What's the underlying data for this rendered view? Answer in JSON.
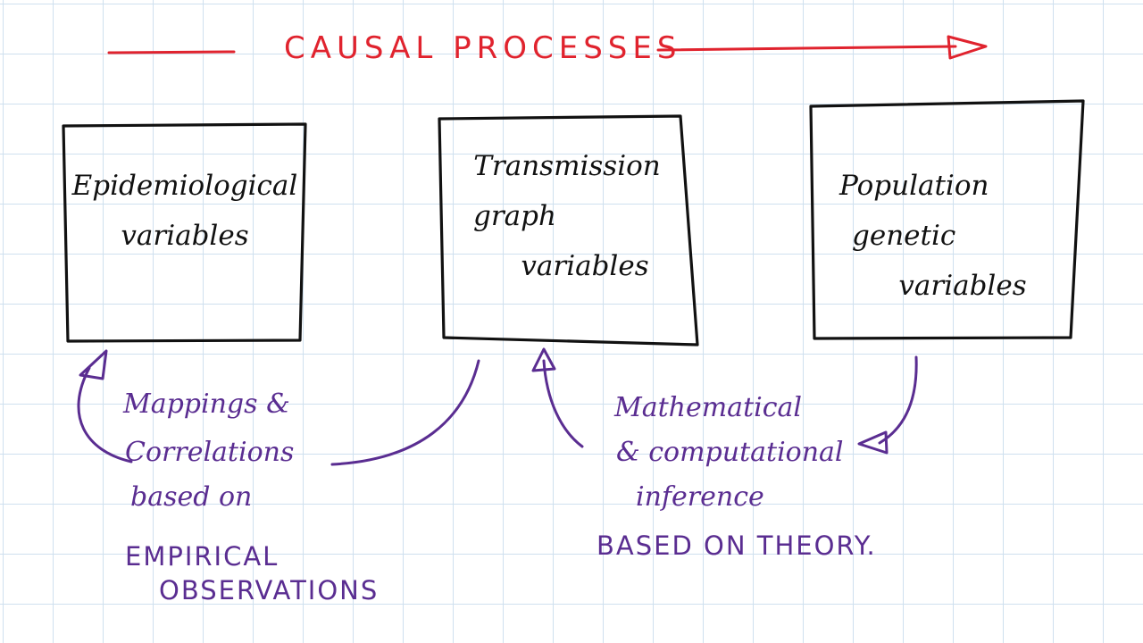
{
  "title": "CAUSAL PROCESSES",
  "boxes": [
    {
      "line1": "Epidemiological",
      "line2": "variables",
      "line3": ""
    },
    {
      "line1": "Transmission",
      "line2": "graph",
      "line3": "variables"
    },
    {
      "line1": "Population",
      "line2": "genetic",
      "line3": "variables"
    }
  ],
  "left_note": {
    "line1": "Mappings &",
    "line2": "Correlations",
    "line3": "based on",
    "line4": "EMPIRICAL",
    "line5": "OBSERVATIONS"
  },
  "right_note": {
    "line1": "Mathematical",
    "line2": "& computational",
    "line3": "inference",
    "line4": "BASED ON THEORY."
  },
  "colors": {
    "title_ink": "#e0232e",
    "box_ink": "#111111",
    "note_ink": "#5a2d91",
    "grid": "#cfe0ef"
  }
}
